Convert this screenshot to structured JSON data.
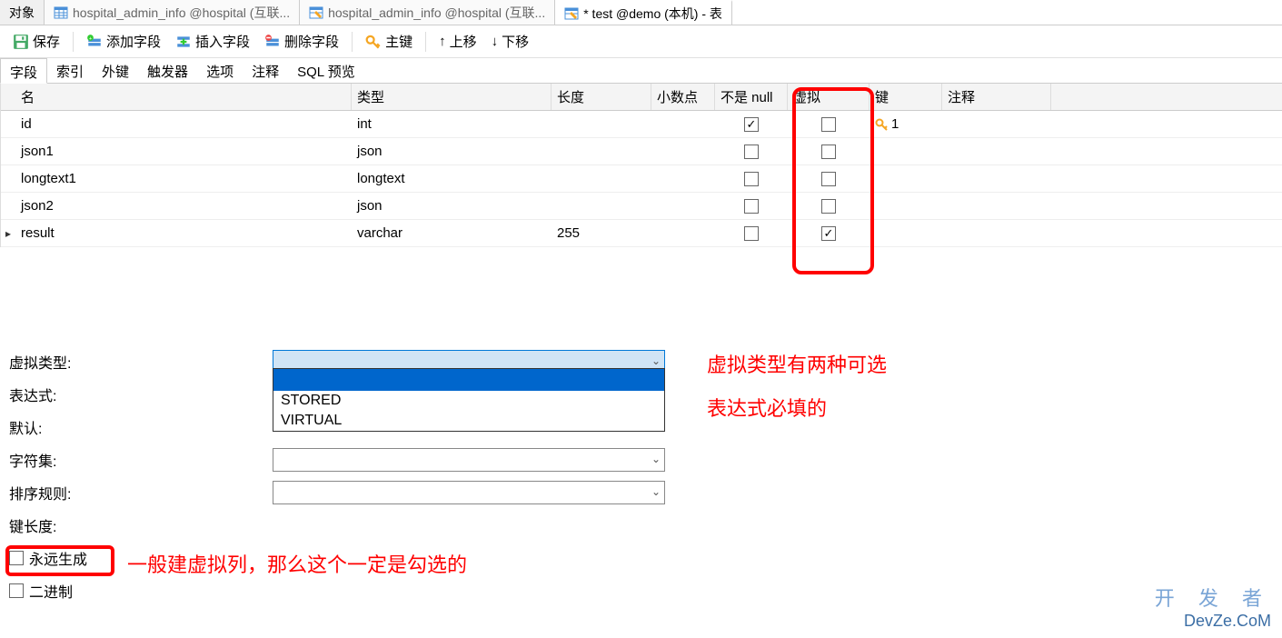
{
  "topTabs": {
    "object": "对象",
    "t1": "hospital_admin_info @hospital (互联...",
    "t2": "hospital_admin_info @hospital (互联...",
    "t3": "* test @demo (本机) - 表"
  },
  "toolbar": {
    "save": "保存",
    "addField": "添加字段",
    "insertField": "插入字段",
    "deleteField": "删除字段",
    "primaryKey": "主键",
    "moveUp": "上移",
    "moveDown": "下移"
  },
  "designerTabs": {
    "fields": "字段",
    "indexes": "索引",
    "fk": "外键",
    "triggers": "触发器",
    "options": "选项",
    "comment": "注释",
    "sqlPreview": "SQL 预览"
  },
  "gridHeaders": {
    "name": "名",
    "type": "类型",
    "length": "长度",
    "decimals": "小数点",
    "notNull": "不是 null",
    "virtual": "虚拟",
    "key": "键",
    "comment": "注释"
  },
  "rows": [
    {
      "name": "id",
      "type": "int",
      "length": "",
      "decimals": "",
      "notNull": true,
      "virtual": false,
      "key": "1",
      "selected": false
    },
    {
      "name": "json1",
      "type": "json",
      "length": "",
      "decimals": "",
      "notNull": false,
      "virtual": false,
      "key": "",
      "selected": false
    },
    {
      "name": "longtext1",
      "type": "longtext",
      "length": "",
      "decimals": "",
      "notNull": false,
      "virtual": false,
      "key": "",
      "selected": false
    },
    {
      "name": "json2",
      "type": "json",
      "length": "",
      "decimals": "",
      "notNull": false,
      "virtual": false,
      "key": "",
      "selected": false
    },
    {
      "name": "result",
      "type": "varchar",
      "length": "255",
      "decimals": "",
      "notNull": false,
      "virtual": true,
      "key": "",
      "selected": true
    }
  ],
  "props": {
    "virtualType": "虚拟类型:",
    "expression": "表达式:",
    "default": "默认:",
    "charset": "字符集:",
    "collation": "排序规则:",
    "keyLength": "键长度:",
    "alwaysGenerate": "永远生成",
    "binary": "二进制"
  },
  "dropdown": {
    "opt1": "STORED",
    "opt2": "VIRTUAL"
  },
  "annotations": {
    "a1": "虚拟类型有两种可选",
    "a2": "表达式必填的",
    "a3": "一般建虚拟列，那么这个一定是勾选的"
  },
  "watermark": {
    "line1": "开 发 者",
    "line2": "DevZe.CoM"
  }
}
